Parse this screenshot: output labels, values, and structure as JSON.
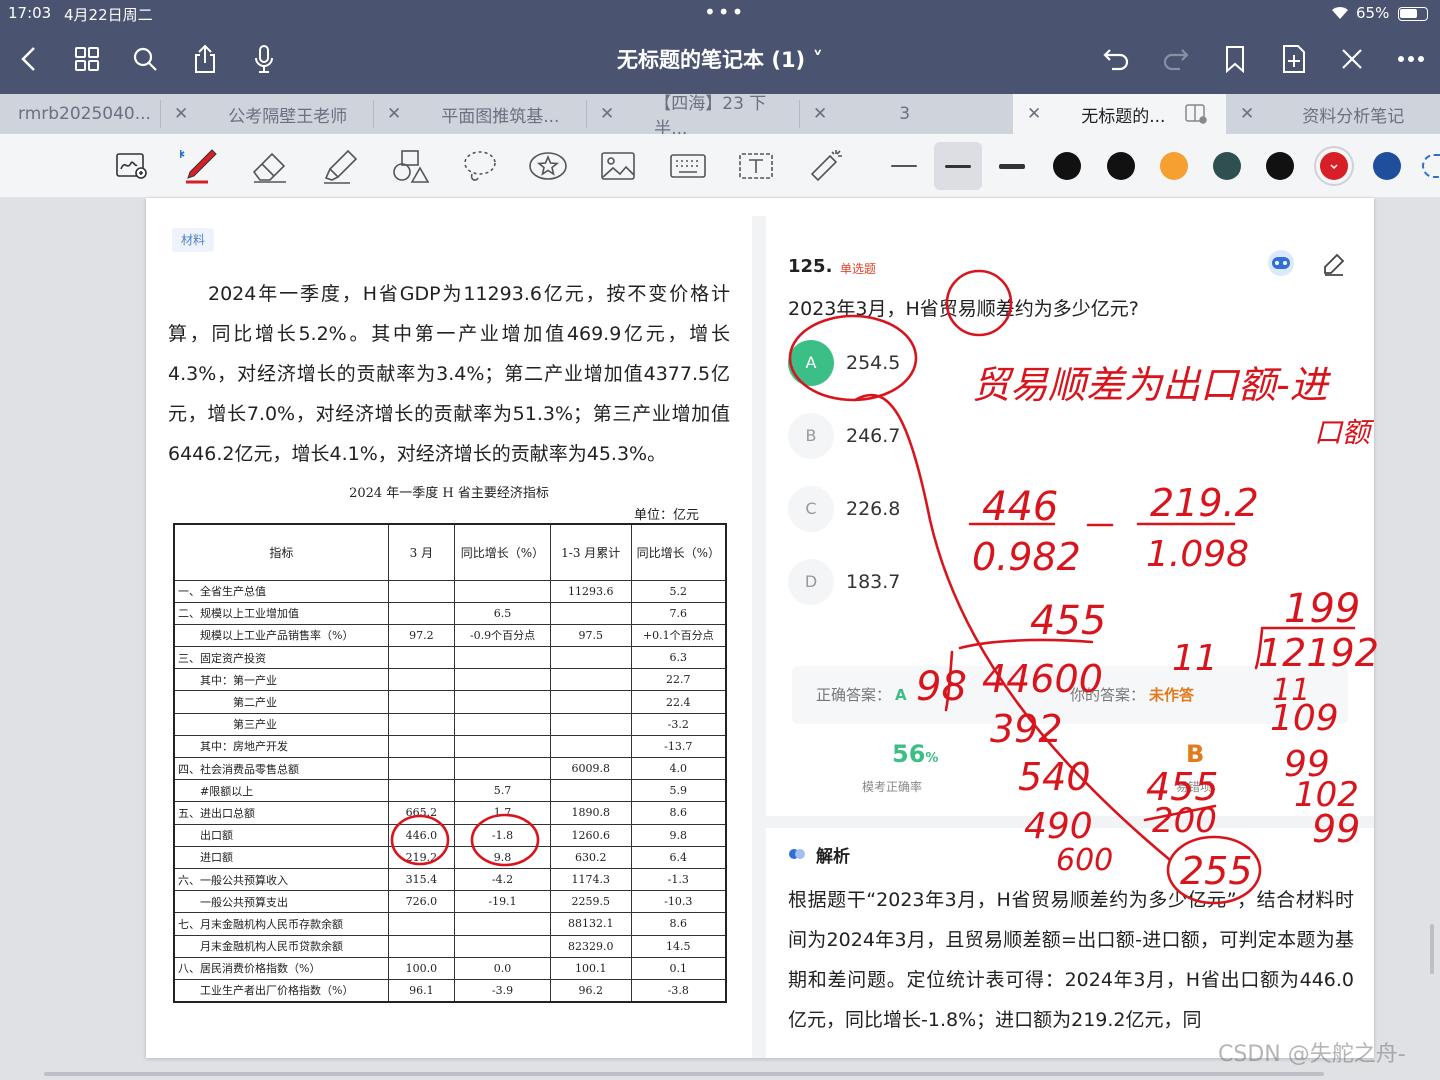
{
  "status": {
    "time": "17:03",
    "date": "4月22日周二",
    "battery": "65%"
  },
  "header": {
    "title": "无标题的笔记本 (1) ˅"
  },
  "tabs": [
    {
      "label": "rmrb2025040..."
    },
    {
      "label": "公考隔壁王老师"
    },
    {
      "label": "平面图推筑基..."
    },
    {
      "label": "【四海】23 下半..."
    },
    {
      "label": "3"
    },
    {
      "label": "无标题的..."
    },
    {
      "label": "资料分析笔记"
    }
  ],
  "toolbar": {
    "colors": [
      "#111111",
      "#111111",
      "#f5a031",
      "#2f4f50",
      "#111111",
      "#d61f26",
      "#1f4e9c"
    ]
  },
  "material": {
    "badge": "材料",
    "text": "2024年一季度，H省GDP为11293.6亿元，按不变价格计算，同比增长5.2%。其中第一产业增加值469.9亿元，增长4.3%，对经济增长的贡献率为3.4%；第二产业增加值4377.5亿元，增长7.0%，对经济增长的贡献率为51.3%；第三产业增加值6446.2亿元，增长4.1%，对经济增长的贡献率为45.3%。",
    "table_title": "2024 年一季度 H 省主要经济指标",
    "unit": "单位：亿元",
    "headers": [
      "指标",
      "3 月",
      "同比增长（%）",
      "1-3 月累计",
      "同比增长（%）"
    ],
    "rows": [
      [
        "一、全省生产总值",
        "",
        "",
        "11293.6",
        "5.2"
      ],
      [
        "二、规模以上工业增加值",
        "",
        "6.5",
        "",
        "7.6"
      ],
      [
        "　　规模以上工业产品销售率（%）",
        "97.2",
        "-0.9个百分点",
        "97.5",
        "+0.1个百分点"
      ],
      [
        "三、固定资产投资",
        "",
        "",
        "",
        "6.3"
      ],
      [
        "　　其中：第一产业",
        "",
        "",
        "",
        "22.7"
      ],
      [
        "　　　　　第二产业",
        "",
        "",
        "",
        "22.4"
      ],
      [
        "　　　　　第三产业",
        "",
        "",
        "",
        "-3.2"
      ],
      [
        "　　其中：房地产开发",
        "",
        "",
        "",
        "-13.7"
      ],
      [
        "四、社会消费品零售总额",
        "",
        "",
        "6009.8",
        "4.0"
      ],
      [
        "　　#限额以上",
        "",
        "5.7",
        "",
        "5.9"
      ],
      [
        "五、进出口总额",
        "665.2",
        "1.7",
        "1890.8",
        "8.6"
      ],
      [
        "　　出口额",
        "446.0",
        "-1.8",
        "1260.6",
        "9.8"
      ],
      [
        "　　进口额",
        "219.2",
        "9.8",
        "630.2",
        "6.4"
      ],
      [
        "六、一般公共预算收入",
        "315.4",
        "-4.2",
        "1174.3",
        "-1.3"
      ],
      [
        "　　一般公共预算支出",
        "726.0",
        "-19.1",
        "2259.5",
        "-10.3"
      ],
      [
        "七、月末金融机构人民币存款余额",
        "",
        "",
        "88132.1",
        "8.6"
      ],
      [
        "　　月末金融机构人民币贷款余额",
        "",
        "",
        "82329.0",
        "14.5"
      ],
      [
        "八、居民消费价格指数（%）",
        "100.0",
        "0.0",
        "100.1",
        "0.1"
      ],
      [
        "　　工业生产者出厂价格指数（%）",
        "96.1",
        "-3.9",
        "96.2",
        "-3.8"
      ]
    ]
  },
  "question": {
    "number": "125.",
    "type": "单选题",
    "text": "2023年3月，H省贸易顺差约为多少亿元?",
    "options": [
      {
        "letter": "A",
        "value": "254.5"
      },
      {
        "letter": "B",
        "value": "246.7"
      },
      {
        "letter": "C",
        "value": "226.8"
      },
      {
        "letter": "D",
        "value": "183.7"
      }
    ],
    "correct_label": "正确答案：",
    "correct": "A",
    "yours_label": "你的答案：",
    "yours": "未作答",
    "rate": "56",
    "rate_unit": "%",
    "rate_label": "模考正确率",
    "wrong_opt": "B",
    "wrong_label": "易错项"
  },
  "analysis": {
    "title": "解析",
    "text": "根据题干“2023年3月，H省贸易顺差约为多少亿元”，结合材料时间为2024年3月，且贸易顺差额=出口额-进口额，可判定本题为基期和差问题。定位统计表可得：2024年3月，H省出口额为446.0亿元，同比增长-1.8%；进口额为219.2亿元，同"
  },
  "handwriting": {
    "note1": "贸易顺差为出口额-进",
    "note2": "口额",
    "calc": [
      "446",
      "0.982",
      "219.2",
      "1.098",
      "455",
      "98",
      "44600",
      "392",
      "540",
      "490",
      "600",
      "11",
      "199",
      "12192",
      "11",
      "109",
      "99",
      "102",
      "99",
      "455",
      "200",
      "255"
    ]
  },
  "watermark": "CSDN @失舵之舟-"
}
